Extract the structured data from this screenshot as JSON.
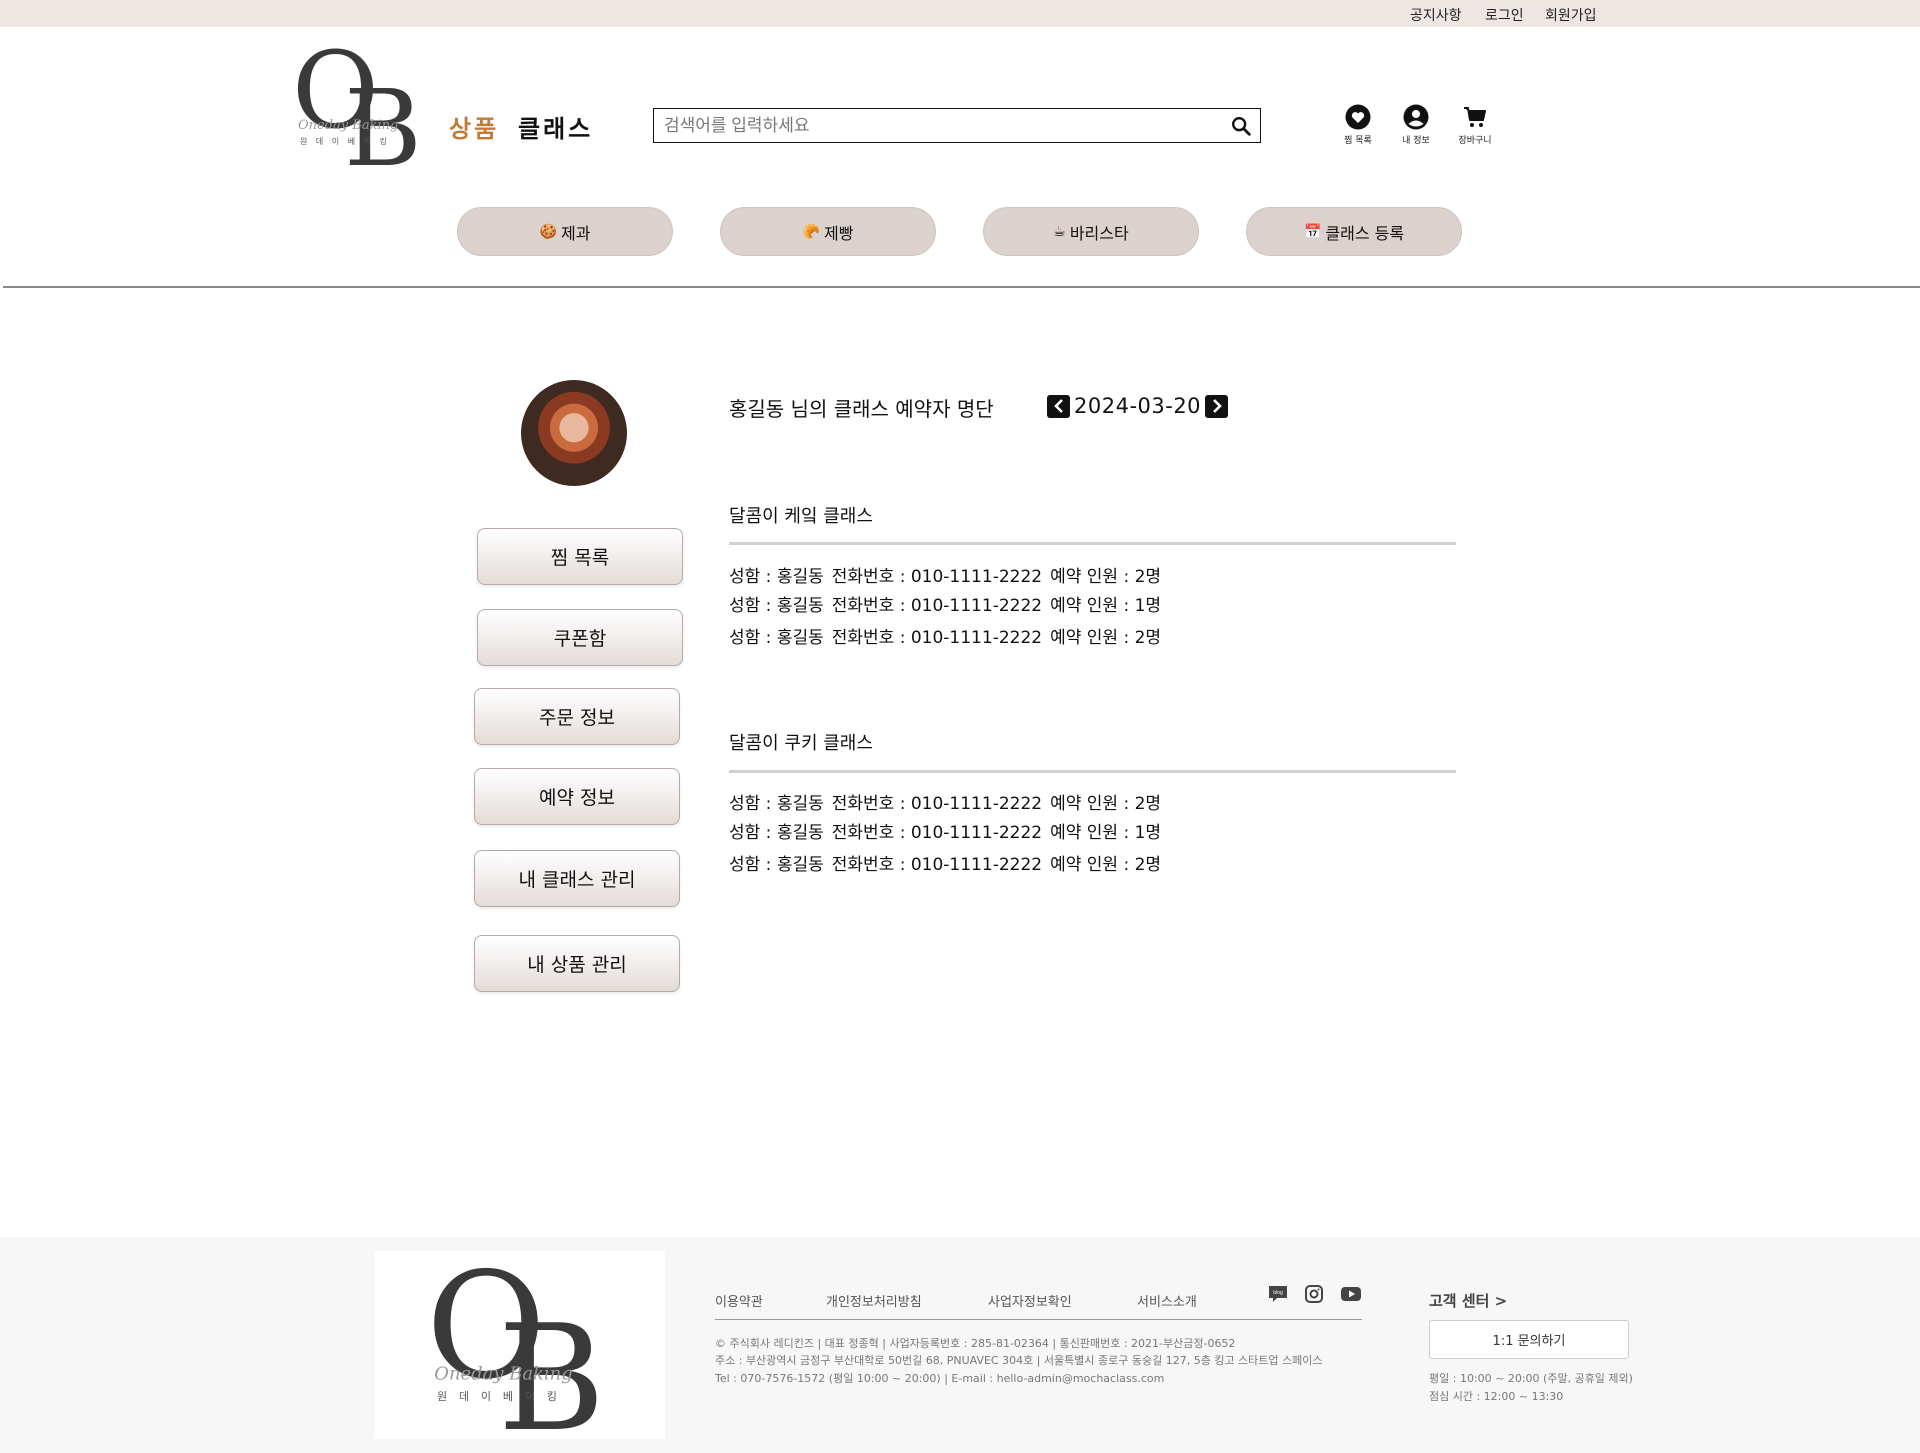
{
  "topbar": {
    "notice": "공지사항",
    "login": "로그인",
    "signup": "회원가입"
  },
  "logo": {
    "letter_o": "O",
    "letter_b": "B",
    "script": "Oneday Baking",
    "korean": "원 데 이 베 이 킹"
  },
  "nav": {
    "product": "상품",
    "class": "클래스"
  },
  "search": {
    "placeholder": "검색어를 입력하세요"
  },
  "header_icons": {
    "wishlist": "찜 목록",
    "my_info": "내 정보",
    "cart": "장바구니"
  },
  "categories": [
    {
      "emoji": "🍪",
      "label": "제과"
    },
    {
      "emoji": "🥐",
      "label": "제빵"
    },
    {
      "emoji": "☕",
      "label": "바리스타"
    },
    {
      "emoji": "📅",
      "label": "클래스 등록"
    }
  ],
  "sidebar": {
    "items": [
      "찜 목록",
      "쿠폰함",
      "주문 정보",
      "예약 정보",
      "내 클래스 관리",
      "내 상품 관리"
    ]
  },
  "main": {
    "heading": "홍길동 님의 클래스 예약자 명단",
    "date": "2024-03-20",
    "classes": [
      {
        "title": "달콤이 케잌 클래스",
        "rows": [
          {
            "name": "성함 : 홍길동",
            "phone": "전화번호 : 010-1111-2222",
            "count": "예약 인원 :  2명"
          },
          {
            "name": "성함 : 홍길동",
            "phone": "전화번호 : 010-1111-2222",
            "count": "예약 인원 :  1명"
          },
          {
            "name": "성함 : 홍길동",
            "phone": "전화번호 : 010-1111-2222",
            "count": "예약 인원 :  2명"
          }
        ]
      },
      {
        "title": "달콤이 쿠키 클래스",
        "rows": [
          {
            "name": "성함 : 홍길동",
            "phone": "전화번호 : 010-1111-2222",
            "count": "예약 인원 :  2명"
          },
          {
            "name": "성함 : 홍길동",
            "phone": "전화번호 : 010-1111-2222",
            "count": "예약 인원 :  1명"
          },
          {
            "name": "성함 : 홍길동",
            "phone": "전화번호 : 010-1111-2222",
            "count": "예약 인원 :  2명"
          }
        ]
      }
    ]
  },
  "footer": {
    "links": [
      "이용약관",
      "개인정보처리방침",
      "사업자정보확인",
      "서비스소개"
    ],
    "sns": [
      "blog-icon",
      "instagram-icon",
      "youtube-icon"
    ],
    "blog_text": "blog",
    "company_line1": "© 주식회사 레디킨즈 | 대표 정종혁 | 사업자등록번호 : 285-81-02364 | 통신판매번호 : 2021-부산금정-0652",
    "company_line2": "주소 : 부산광역시 금정구 부산대학로 50번길 68, PNUAVEC 304호 | 서울특별시 종로구 동숭길 127, 5층 킹고 스타트업 스페이스",
    "company_line3": "Tel : 070-7576-1572 (평일 10:00 ~ 20:00) | E-mail : hello-admin@mochaclass.com",
    "cs_title": "고객 센터 >",
    "cs_button": "1:1 문의하기",
    "cs_hours": "평일 : 10:00 ~ 20:00 (주말, 공휴일 제외)",
    "cs_lunch": "점심 시간 : 12:00 ~ 13:30"
  },
  "colors": {
    "accent": "#c47a35",
    "category_bg": "#dbd1cd",
    "topbar_bg": "#ede6e3"
  }
}
